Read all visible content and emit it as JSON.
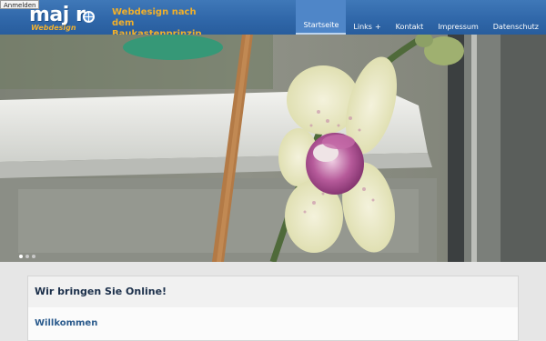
{
  "topbar": {
    "login_label": "Anmelden"
  },
  "logo": {
    "word": "maj r",
    "sub": "Webdesign"
  },
  "tagline": "Webdesign nach dem Baukastenprinzip",
  "nav": {
    "items": [
      {
        "label": "Startseite"
      },
      {
        "label": "Links",
        "caret": "+"
      },
      {
        "label": "Kontakt"
      },
      {
        "label": "Impressum"
      },
      {
        "label": "Datenschutz"
      }
    ]
  },
  "slider": {
    "slides": 3,
    "active": 1
  },
  "content": {
    "heading": "Wir bringen Sie Online!",
    "subheading": "Willkommen"
  },
  "colors": {
    "header": "#2f66a8",
    "accent": "#f2b02a",
    "heading": "#1b2f4a",
    "link": "#2a5a8c"
  }
}
